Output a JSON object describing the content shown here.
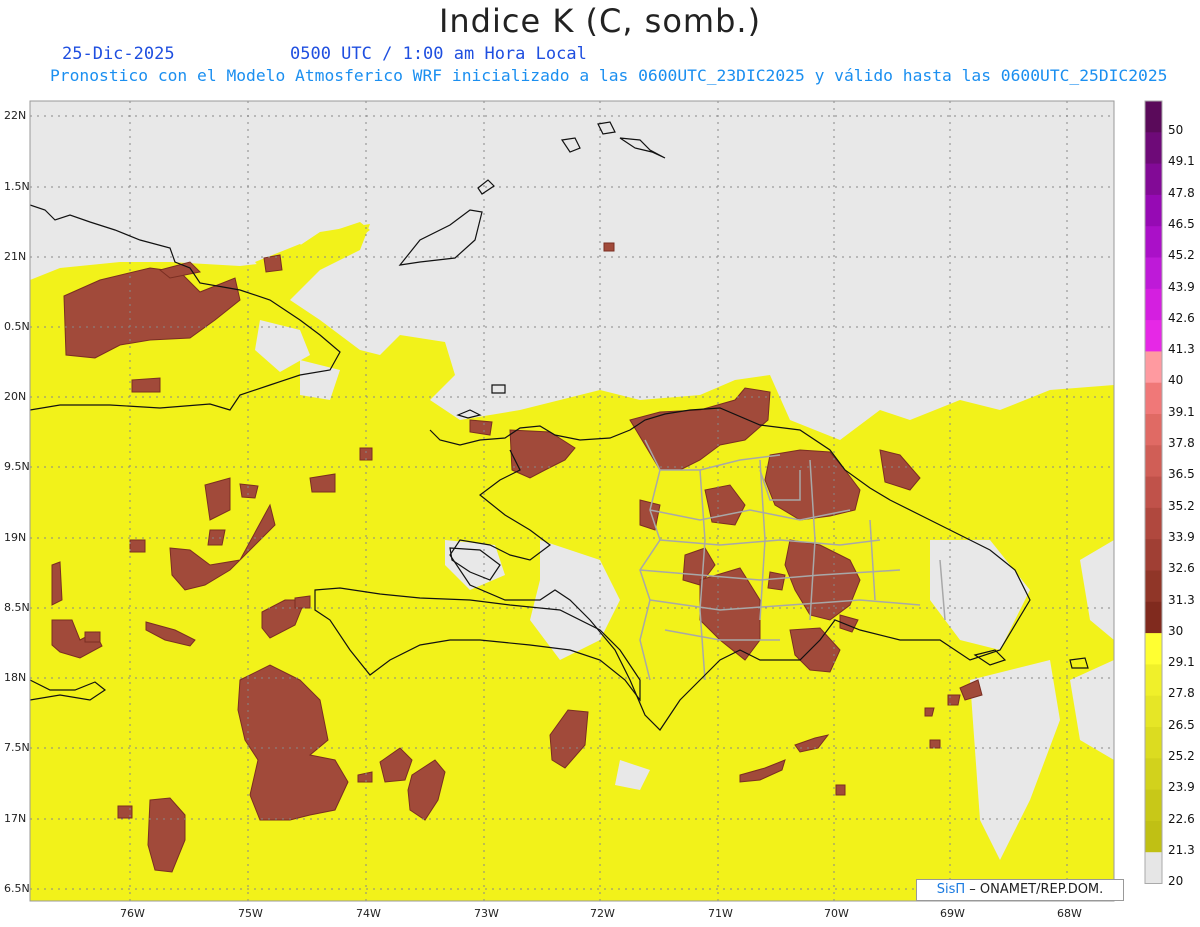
{
  "header": {
    "title": "Indice K (C, somb.)",
    "date": "25-Dic-2025",
    "time": "0500 UTC / 1:00 am Hora Local",
    "description": "Pronostico con el Modelo Atmosferico WRF inicializado a las 0600UTC_23DIC2025 y válido hasta las  0600UTC_25DIC2025"
  },
  "map": {
    "lat_labels": [
      "22N",
      "1.5N",
      "21N",
      "0.5N",
      "20N",
      "9.5N",
      "19N",
      "8.5N",
      "18N",
      "7.5N",
      "17N",
      "6.5N"
    ],
    "lon_labels": [
      "76W",
      "75W",
      "74W",
      "73W",
      "72W",
      "71W",
      "70W",
      "69W",
      "68W"
    ],
    "colors": {
      "background": "#e8e8e8",
      "k_20_30": "#f2f21a",
      "k_30_plus": "#a14a3a",
      "coastline": "#000000",
      "provinces": "#aaaaaa"
    }
  },
  "colorbar": {
    "labels": [
      "50",
      "49.1",
      "47.8",
      "46.5",
      "45.2",
      "43.9",
      "42.6",
      "41.3",
      "40",
      "39.1",
      "37.8",
      "36.5",
      "35.2",
      "33.9",
      "32.6",
      "31.3",
      "30",
      "29.1",
      "27.8",
      "26.5",
      "25.2",
      "23.9",
      "22.6",
      "21.3",
      "20"
    ],
    "colors": [
      "#5a0a5a",
      "#6e0a78",
      "#820a96",
      "#960ab4",
      "#aa10c8",
      "#be1ad8",
      "#d41fe0",
      "#e628e6",
      "#ff9aa0",
      "#f07878",
      "#e06a64",
      "#d05e56",
      "#c0524a",
      "#b0483e",
      "#a03f34",
      "#903628",
      "#802a1e",
      "#ffff32",
      "#f0f02a",
      "#e6e626",
      "#dcdc20",
      "#d2d21c",
      "#c8c818",
      "#c0c014",
      "#e6e6e6"
    ]
  },
  "credit": {
    "logo": "SisΠ",
    "text": "– ONAMET/REP.DOM."
  }
}
